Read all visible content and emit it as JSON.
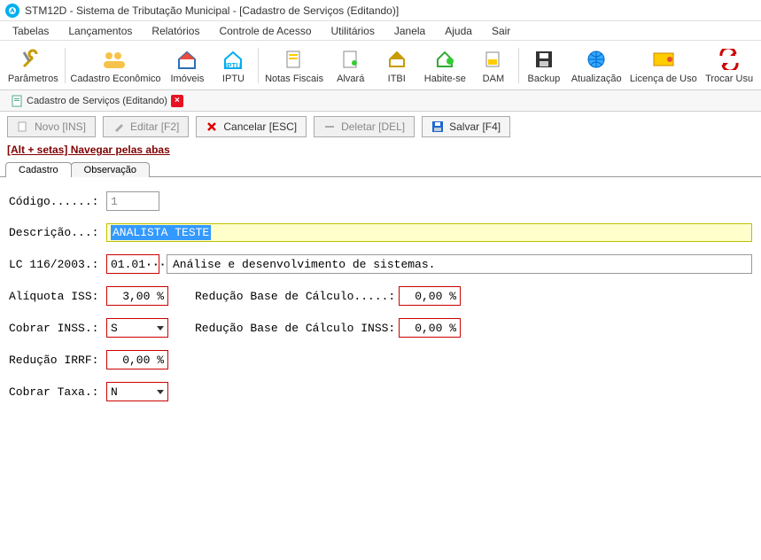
{
  "title": "STM12D - Sistema de Tributação Municipal - [Cadastro de Serviços (Editando)]",
  "menu": [
    "Tabelas",
    "Lançamentos",
    "Relatórios",
    "Controle de Acesso",
    "Utilitários",
    "Janela",
    "Ajuda",
    "Sair"
  ],
  "toolbar": [
    {
      "label": "Parâmetros",
      "icon": "wrench"
    },
    {
      "label": "Cadastro Econômico",
      "icon": "group"
    },
    {
      "label": "Imóveis",
      "icon": "house"
    },
    {
      "label": "IPTU",
      "icon": "iptu"
    },
    {
      "label": "Notas Fiscais",
      "icon": "note"
    },
    {
      "label": "Alvará",
      "icon": "cert"
    },
    {
      "label": "ITBI",
      "icon": "house2"
    },
    {
      "label": "Habite-se",
      "icon": "habite"
    },
    {
      "label": "DAM",
      "icon": "dam"
    },
    {
      "label": "Backup",
      "icon": "save"
    },
    {
      "label": "Atualização",
      "icon": "globe"
    },
    {
      "label": "Licença de Uso",
      "icon": "license"
    },
    {
      "label": "Trocar Usu",
      "icon": "swap"
    }
  ],
  "doc_tab": {
    "label": "Cadastro de Serviços (Editando)"
  },
  "actions": {
    "novo": "Novo [INS]",
    "editar": "Editar [F2]",
    "cancelar": "Cancelar [ESC]",
    "deletar": "Deletar [DEL]",
    "salvar": "Salvar [F4]"
  },
  "hint": "[Alt + setas] Navegar pelas abas",
  "tabs": {
    "cadastro": "Cadastro",
    "observacao": "Observação"
  },
  "form": {
    "labels": {
      "codigo": "Código......:",
      "descricao": "Descrição...:",
      "lc": "LC 116/2003.:",
      "aliq": "Alíquota ISS:",
      "cobrar_inss": "Cobrar INSS.:",
      "reducao_irrf": "Redução IRRF:",
      "cobrar_taxa": "Cobrar Taxa.:",
      "red_base": "Redução Base de Cálculo.....:",
      "red_base_inss": "Redução Base de Cálculo INSS:"
    },
    "codigo": "1",
    "descricao": "ANALISTA TESTE",
    "lc_code": "01.01",
    "lc_desc": "Análise e desenvolvimento de sistemas.",
    "aliquota": "3,00 %",
    "red_base": "0,00 %",
    "cobrar_inss": "S",
    "red_base_inss": "0,00 %",
    "reducao_irrf": "0,00 %",
    "cobrar_taxa": "N"
  }
}
